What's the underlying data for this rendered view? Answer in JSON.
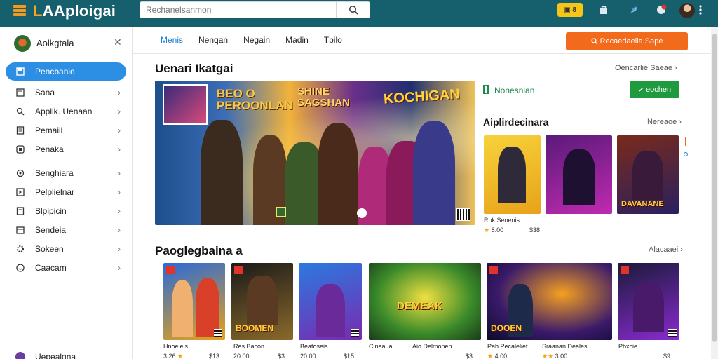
{
  "header": {
    "logo_prefix": "L",
    "logo_rest": "AAploigai",
    "search_placeholder": "Rechanelsanmon",
    "wallet_label": "8"
  },
  "sidebar": {
    "user_name": "Aolkgtala",
    "items": [
      {
        "label": "Pencbanio",
        "icon": "bookmark-icon"
      },
      {
        "label": "Sana",
        "icon": "list-icon"
      },
      {
        "label": "Applik. Uenaan",
        "icon": "search-icon"
      },
      {
        "label": "Pemaiil",
        "icon": "document-icon"
      },
      {
        "label": "Penaka",
        "icon": "square-icon"
      },
      {
        "label": "Senghiara",
        "icon": "gear-icon"
      },
      {
        "label": "Pelplielnar",
        "icon": "play-icon"
      },
      {
        "label": "Blpipicin",
        "icon": "document-icon"
      },
      {
        "label": "Sendeia",
        "icon": "calendar-icon"
      },
      {
        "label": "Sokeen",
        "icon": "settings-icon"
      },
      {
        "label": "Caacam",
        "icon": "smiley-icon"
      }
    ],
    "bottom_label": "Uepealgna"
  },
  "tabs": [
    "Menis",
    "Nenqan",
    "Negain",
    "Madin",
    "Tbilo"
  ],
  "promo_button": "Recaedaeila Sape",
  "featured": {
    "title": "Uenari Ikatgai",
    "link": "Oencarlie Saeae",
    "hero_text_a": "BEO O\nPEROONLAN",
    "hero_text_b": "SHINE\nSAGSHAN",
    "hero_text_c": "KOCHIGAN"
  },
  "right_panel": {
    "header": "Nonesnlan",
    "button": "eochen",
    "section_title": "Aiplirdecinara",
    "section_link": "Nereaoe",
    "card_caption": "Ruk Seoenis",
    "rating": "8.00",
    "price": "$38",
    "mini_label": "DAVANANE"
  },
  "popular": {
    "title": "Paoglegbaina a",
    "link": "Alacaaei",
    "cards": [
      {
        "title": "",
        "name": "Hnoeleis",
        "rating": "3.26",
        "price": "$13"
      },
      {
        "title": "BOOMEN",
        "name": "Res Bacon",
        "rating": "20.00",
        "price": "$3"
      },
      {
        "title": "",
        "name": "Beatoseis",
        "rating": "20.00",
        "price": "$15"
      },
      {
        "title": "DEMEAK",
        "name": "Cineaua",
        "rating": "",
        "price": ""
      },
      {
        "title": "DOOEN",
        "name": "Aio Delmonen",
        "rating": "",
        "price": "$3"
      },
      {
        "title": "",
        "name": "Pab Pecaleliet",
        "rating": "4.00",
        "price": ""
      },
      {
        "title": "",
        "name": "Sraanan Deales",
        "rating": "3.00",
        "price": ""
      },
      {
        "title": "",
        "name": "Pbxcie",
        "rating": "",
        "price": "$9"
      }
    ]
  }
}
